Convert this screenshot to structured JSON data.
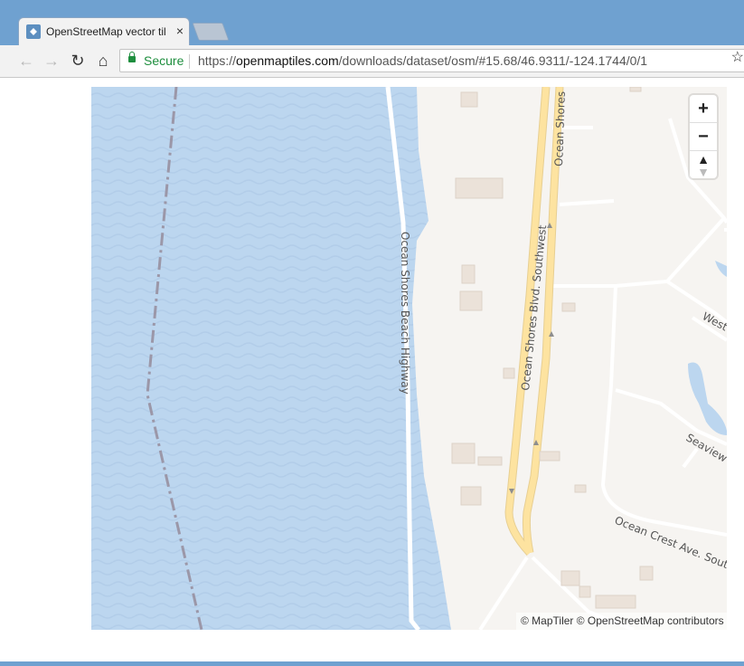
{
  "browser": {
    "tab_title": "OpenStreetMap vector til",
    "tab_close": "×",
    "back": "←",
    "forward": "→",
    "reload": "↻",
    "home": "⌂",
    "secure_label": "Secure",
    "url_scheme": "https://",
    "url_host": "openmaptiles.com",
    "url_path": "/downloads/dataset/osm/#15.68/46.9311/-124.1744/0/1",
    "star": "☆"
  },
  "map": {
    "zoom_in": "+",
    "zoom_out": "−",
    "compass": "▲\n▼",
    "attribution": "© MapTiler © OpenStreetMap contributors",
    "labels": {
      "ocean_shores_beach_highway": "Ocean Shores Beach Highway",
      "ocean_shores_blvd_sw": "Ocean Shores Blvd. Southwest",
      "ocean_shores_blvd_top": "Ocean Shores B",
      "west": "West",
      "seaview": "Seaview",
      "ocean_crest": "Ocean Crest Ave. South"
    },
    "colors": {
      "water": "#bcd6ef",
      "land": "#f6f4f1",
      "road_major": "#fde3a0",
      "road_minor": "#ffffff",
      "building": "#ebe2d9",
      "boundary": "#9b97a8"
    }
  }
}
